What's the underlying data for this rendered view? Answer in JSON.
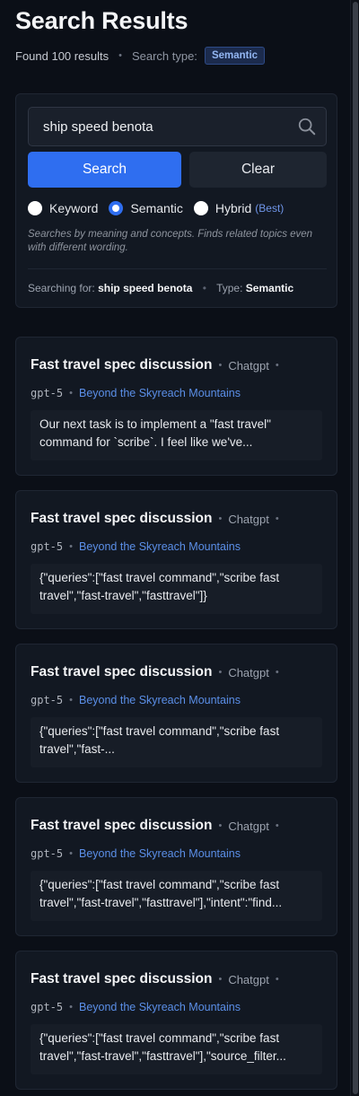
{
  "header": {
    "title": "Search Results",
    "found": "Found 100 results",
    "search_type_label": "Search type:",
    "search_type_badge": "Semantic"
  },
  "search": {
    "query": "ship speed benota",
    "search_button": "Search",
    "clear_button": "Clear",
    "modes": [
      {
        "label": "Keyword",
        "checked": false
      },
      {
        "label": "Semantic",
        "checked": true
      },
      {
        "label": "Hybrid",
        "checked": false,
        "tag": "(Best)"
      }
    ],
    "helper": "Searches by meaning and concepts. Finds related topics even with different wording.",
    "status": {
      "prefix": "Searching for:",
      "query": "ship speed benota",
      "type_prefix": "Type:",
      "type": "Semantic"
    }
  },
  "results": [
    {
      "title": "Fast travel spec discussion",
      "source": "Chatgpt",
      "model": "gpt-5",
      "project": "Beyond the Skyreach Mountains",
      "snippet": "Our next task is to implement a \"fast travel\" command for `scribe`. I feel like we've..."
    },
    {
      "title": "Fast travel spec discussion",
      "source": "Chatgpt",
      "model": "gpt-5",
      "project": "Beyond the Skyreach Mountains",
      "snippet": "{\"queries\":[\"fast travel command\",\"scribe fast travel\",\"fast-travel\",\"fasttravel\"]}"
    },
    {
      "title": "Fast travel spec discussion",
      "source": "Chatgpt",
      "model": "gpt-5",
      "project": "Beyond the Skyreach Mountains",
      "snippet": "{\"queries\":[\"fast travel command\",\"scribe fast travel\",\"fast-..."
    },
    {
      "title": "Fast travel spec discussion",
      "source": "Chatgpt",
      "model": "gpt-5",
      "project": "Beyond the Skyreach Mountains",
      "snippet": "{\"queries\":[\"fast travel command\",\"scribe fast travel\",\"fast-travel\",\"fasttravel\"],\"intent\":\"find..."
    },
    {
      "title": "Fast travel spec discussion",
      "source": "Chatgpt",
      "model": "gpt-5",
      "project": "Beyond the Skyreach Mountains",
      "snippet": "{\"queries\":[\"fast travel command\",\"scribe fast travel\",\"fast-travel\",\"fasttravel\"],\"source_filter..."
    }
  ],
  "colors": {
    "background": "#0b0f17",
    "card": "#121822",
    "accent": "#2f6ef0",
    "link": "#5b8fe8"
  }
}
